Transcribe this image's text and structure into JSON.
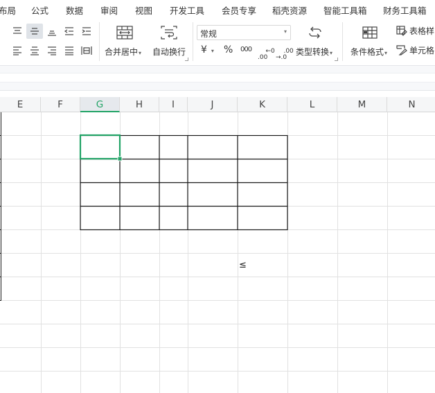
{
  "menu": {
    "tabs": [
      "布局",
      "公式",
      "数据",
      "审阅",
      "视图",
      "开发工具",
      "会员专享",
      "稻壳资源",
      "智能工具箱",
      "财务工具箱"
    ]
  },
  "ribbon": {
    "merge_label": "合并居中",
    "wrap_label": "自动换行",
    "number_format": "常规",
    "currency_symbol": "¥",
    "percent_symbol": "%",
    "thousands_symbol": "000",
    "decimal_increase": "←0\n.00",
    "decimal_decrease": ".00\n→.0",
    "type_convert_label": "类型转换",
    "cond_format_label": "条件格式",
    "table_style_label": "表格样",
    "cell_style_label": "单元格"
  },
  "sheet": {
    "columns": [
      "E",
      "F",
      "G",
      "H",
      "I",
      "J",
      "K",
      "L",
      "M",
      "N"
    ],
    "active_column": "G",
    "cell_text": "≤"
  },
  "colors": {
    "accent": "#21a366",
    "grid": "#e1e1e1",
    "border": "#1a1a1a"
  }
}
